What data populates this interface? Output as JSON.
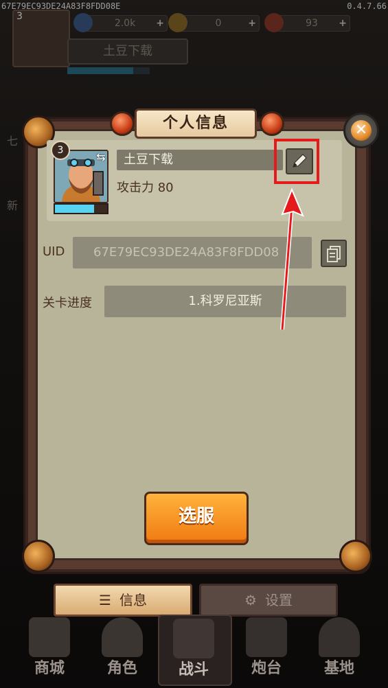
{
  "status": {
    "uid_text": "67E79EC93DE24A83F8FDD08E",
    "version": "0.4.7.66"
  },
  "resources": [
    {
      "icon": "diamond-icon",
      "value": "2.0k"
    },
    {
      "icon": "coin-icon",
      "value": "0"
    },
    {
      "icon": "meat-icon",
      "value": "93"
    }
  ],
  "background": {
    "player_level": "3",
    "player_name": "土豆下载",
    "exp_fraction": 0.8,
    "side_text_1": "七",
    "side_text_2": "新"
  },
  "dialog": {
    "title": "个人信息",
    "close_glyph": "✕",
    "profile": {
      "level": "3",
      "name": "土豆下载",
      "attack_label": "攻击力 80",
      "exp_fraction": 0.75
    },
    "uid_label": "UID",
    "uid_value": "67E79EC93DE24A83F8FDD08",
    "stage_label": "关卡进度",
    "stage_value": "1.科罗尼亚斯",
    "server_button": "选服"
  },
  "tabs": {
    "info_label": "信息",
    "settings_label": "设置"
  },
  "nav": [
    {
      "label": "商城",
      "icon": "chest-icon"
    },
    {
      "label": "角色",
      "icon": "hooded-character-icon"
    },
    {
      "label": "战斗",
      "icon": "crossed-cannons-icon"
    },
    {
      "label": "炮台",
      "icon": "cannon-icon"
    },
    {
      "label": "基地",
      "icon": "base-tower-icon"
    }
  ],
  "colors": {
    "accent_orange": "#f07a12",
    "highlight_red": "#e51b1b",
    "exp_blue": "#58d2f0"
  }
}
